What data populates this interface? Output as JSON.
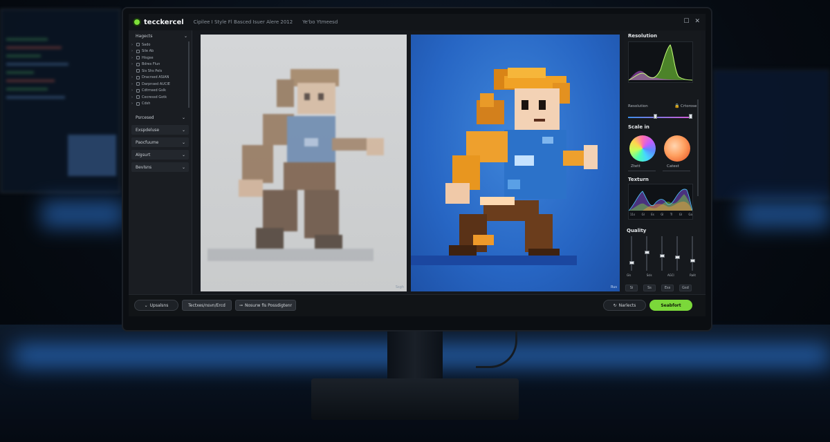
{
  "app": {
    "title": "tecckercel",
    "menu_text": "Cipilee I Style Fl Basced Isuer Alere 2012",
    "menu_text_2": "Ye'bo Ytmeesd",
    "window_controls": [
      "☐",
      "✕"
    ]
  },
  "left_panel": {
    "header": "Hagects",
    "tree": [
      {
        "arrow": "›",
        "label": "Sado"
      },
      {
        "arrow": "›",
        "label": "Sile Ab"
      },
      {
        "arrow": "›",
        "label": "Hisgse"
      },
      {
        "arrow": "›",
        "label": "Bdres Flun"
      },
      {
        "arrow": "",
        "label": "Sis Shs Pels"
      },
      {
        "arrow": "›",
        "label": "Dracrsed ASIAN"
      },
      {
        "arrow": "›",
        "label": "Darpnsed AUCIE"
      },
      {
        "arrow": "›",
        "label": "Cdtrnsed Gslk"
      },
      {
        "arrow": "›",
        "label": "Cecressd Gotk"
      },
      {
        "arrow": "›",
        "label": "Cdsh"
      }
    ],
    "plain_section": "Psrcesed",
    "sections": [
      "Exspdeluse",
      "Paocfuume",
      "Algsurt",
      "Bevlsns"
    ]
  },
  "panes": {
    "original_label": "Ssgh",
    "upscaled_label": "Rus"
  },
  "right_panel": {
    "resolution_title": "Resolution",
    "resolution_slider_label": "Resolution",
    "resolution_toggle": "Crtorose",
    "resolution_slider_value": 0.42,
    "scale_title": "Scale in",
    "wheel_a_label": "Ztett",
    "wheel_b_label": "Catest",
    "texture_title": "Texturn",
    "texture_ticks": [
      "11s",
      "Gl",
      "Es",
      "Gl",
      "Tl",
      "Gl",
      "Ga"
    ],
    "quality_title": "Quality",
    "quality_fader_labels": [
      "Gls",
      "Ssls",
      "AGCl",
      "Ralit"
    ],
    "quality_faders": [
      0.25,
      0.55,
      0.45,
      0.4,
      0.3
    ],
    "quality_buttons": [
      "Si",
      "Ss",
      "Ess",
      "Gsd"
    ]
  },
  "bottom_bar": {
    "upscale_toggle": "Upsalsns",
    "export_button": "Tectxes/nsvn/Ercd",
    "compare_button": "Nosurw fis Possdigtenr",
    "secondary_action": "Narlects",
    "primary_action": "Seabfort"
  },
  "colors": {
    "accent_green": "#7bd83a",
    "canvas_blue": "#2766c4",
    "panel_dark": "#16191d"
  }
}
